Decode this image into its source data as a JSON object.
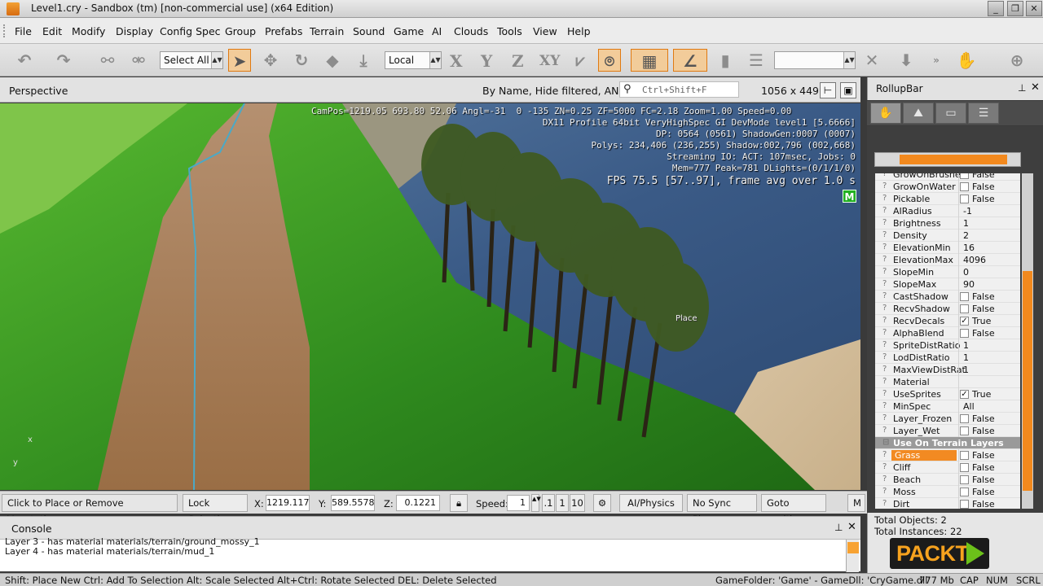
{
  "window": {
    "title": "Level1.cry - Sandbox (tm) [non-commercial use] (x64 Edition)"
  },
  "menu": [
    "File",
    "Edit",
    "Modify",
    "Display",
    "Config Spec",
    "Group",
    "Prefabs",
    "Terrain",
    "Sound",
    "Game",
    "AI",
    "Clouds",
    "Tools",
    "View",
    "Help"
  ],
  "toolbar": {
    "select_all": "Select All",
    "coord_system": "Local",
    "axis_x": "X",
    "axis_y": "Y",
    "axis_z": "Z",
    "axis_xy": "XY"
  },
  "viewport": {
    "title": "Perspective",
    "filter_label": "By Name, Hide filtered, AND",
    "search_placeholder": "Ctrl+Shift+F",
    "resolution": "1056 x 449",
    "hud": [
      "CamPos=1219.05 693.80 52.06 Angl=-31  0 -135 ZN=0.25 ZF=5000 FC=2.18 Zoom=1.00 Speed=0.00",
      "DX11 Profile 64bit VeryHighSpec GI DevMode level1 [5.6666]",
      "DP: 0564 (0561) ShadowGen:0007 (0007)",
      "Polys: 234,406 (236,255) Shadow:002,796 (002,668)",
      "Streaming IO: ACT: 107msec, Jobs: 0",
      "Mem=777 Peak=781 DLights=(0/1/1/0)"
    ],
    "fps": "FPS 75.5 [57..97], frame avg over 1.0 s",
    "m_badge": "M",
    "place_label": "Place",
    "gizmo_x": "x",
    "gizmo_y": "y"
  },
  "status_row": {
    "hint": "Click to Place or Remove Vegetation",
    "lock_selection": "Lock Selection",
    "x_label": "X:",
    "x_value": "1219.117",
    "y_label": "Y:",
    "y_value": "589.5578",
    "z_label": "Z:",
    "z_value": "0.1221",
    "speed_label": "Speed:",
    "speed_value": "1",
    "speed_presets": [
      ".1",
      "1",
      "10"
    ],
    "ai_physics": "AI/Physics",
    "no_sync": "No Sync Player",
    "goto": "Goto position",
    "more": "M"
  },
  "console": {
    "title": "Console",
    "lines": [
      "Layer 3 - has material materials/terrain/ground_mossy_1",
      "Layer 4 - has material materials/terrain/mud_1"
    ]
  },
  "statusbar": {
    "shortcuts": "Shift: Place New  Ctrl: Add To Selection  Alt: Scale Selected  Alt+Ctrl: Rotate Selected DEL: Delete Selected",
    "gamefolder": "GameFolder: 'Game' - GameDll: 'CryGame.dll'",
    "memory": "777 Mb",
    "cap": "CAP",
    "num": "NUM",
    "scrl": "SCRL"
  },
  "rollup": {
    "title": "RollupBar",
    "properties": [
      {
        "name": "GrowOnBrushes",
        "check": false,
        "value": "False"
      },
      {
        "name": "GrowOnWater",
        "check": false,
        "value": "False"
      },
      {
        "name": "Pickable",
        "check": false,
        "value": "False"
      },
      {
        "name": "AIRadius",
        "value": "-1"
      },
      {
        "name": "Brightness",
        "value": "1"
      },
      {
        "name": "Density",
        "value": "2"
      },
      {
        "name": "ElevationMin",
        "value": "16"
      },
      {
        "name": "ElevationMax",
        "value": "4096"
      },
      {
        "name": "SlopeMin",
        "value": "0"
      },
      {
        "name": "SlopeMax",
        "value": "90"
      },
      {
        "name": "CastShadow",
        "check": false,
        "value": "False"
      },
      {
        "name": "RecvShadow",
        "check": false,
        "value": "False"
      },
      {
        "name": "RecvDecals",
        "check": true,
        "value": "True"
      },
      {
        "name": "AlphaBlend",
        "check": false,
        "value": "False"
      },
      {
        "name": "SpriteDistRatio",
        "value": "1"
      },
      {
        "name": "LodDistRatio",
        "value": "1"
      },
      {
        "name": "MaxViewDistRat",
        "value": "1"
      },
      {
        "name": "Material",
        "value": ""
      },
      {
        "name": "UseSprites",
        "check": true,
        "value": "True"
      },
      {
        "name": "MinSpec",
        "value": "All"
      },
      {
        "name": "Layer_Frozen",
        "check": false,
        "value": "False"
      },
      {
        "name": "Layer_Wet",
        "check": false,
        "value": "False"
      },
      {
        "name": "Use On Terrain Layers",
        "section": true
      },
      {
        "name": "Grass",
        "check": false,
        "value": "False",
        "selected": true
      },
      {
        "name": "Cliff",
        "check": false,
        "value": "False"
      },
      {
        "name": "Beach",
        "check": false,
        "value": "False"
      },
      {
        "name": "Moss",
        "check": false,
        "value": "False"
      },
      {
        "name": "Dirt",
        "check": false,
        "value": "False"
      }
    ],
    "total_objects": "Total Objects: 2",
    "total_instances": "Total Instances: 22"
  },
  "watermark": "PACKT"
}
